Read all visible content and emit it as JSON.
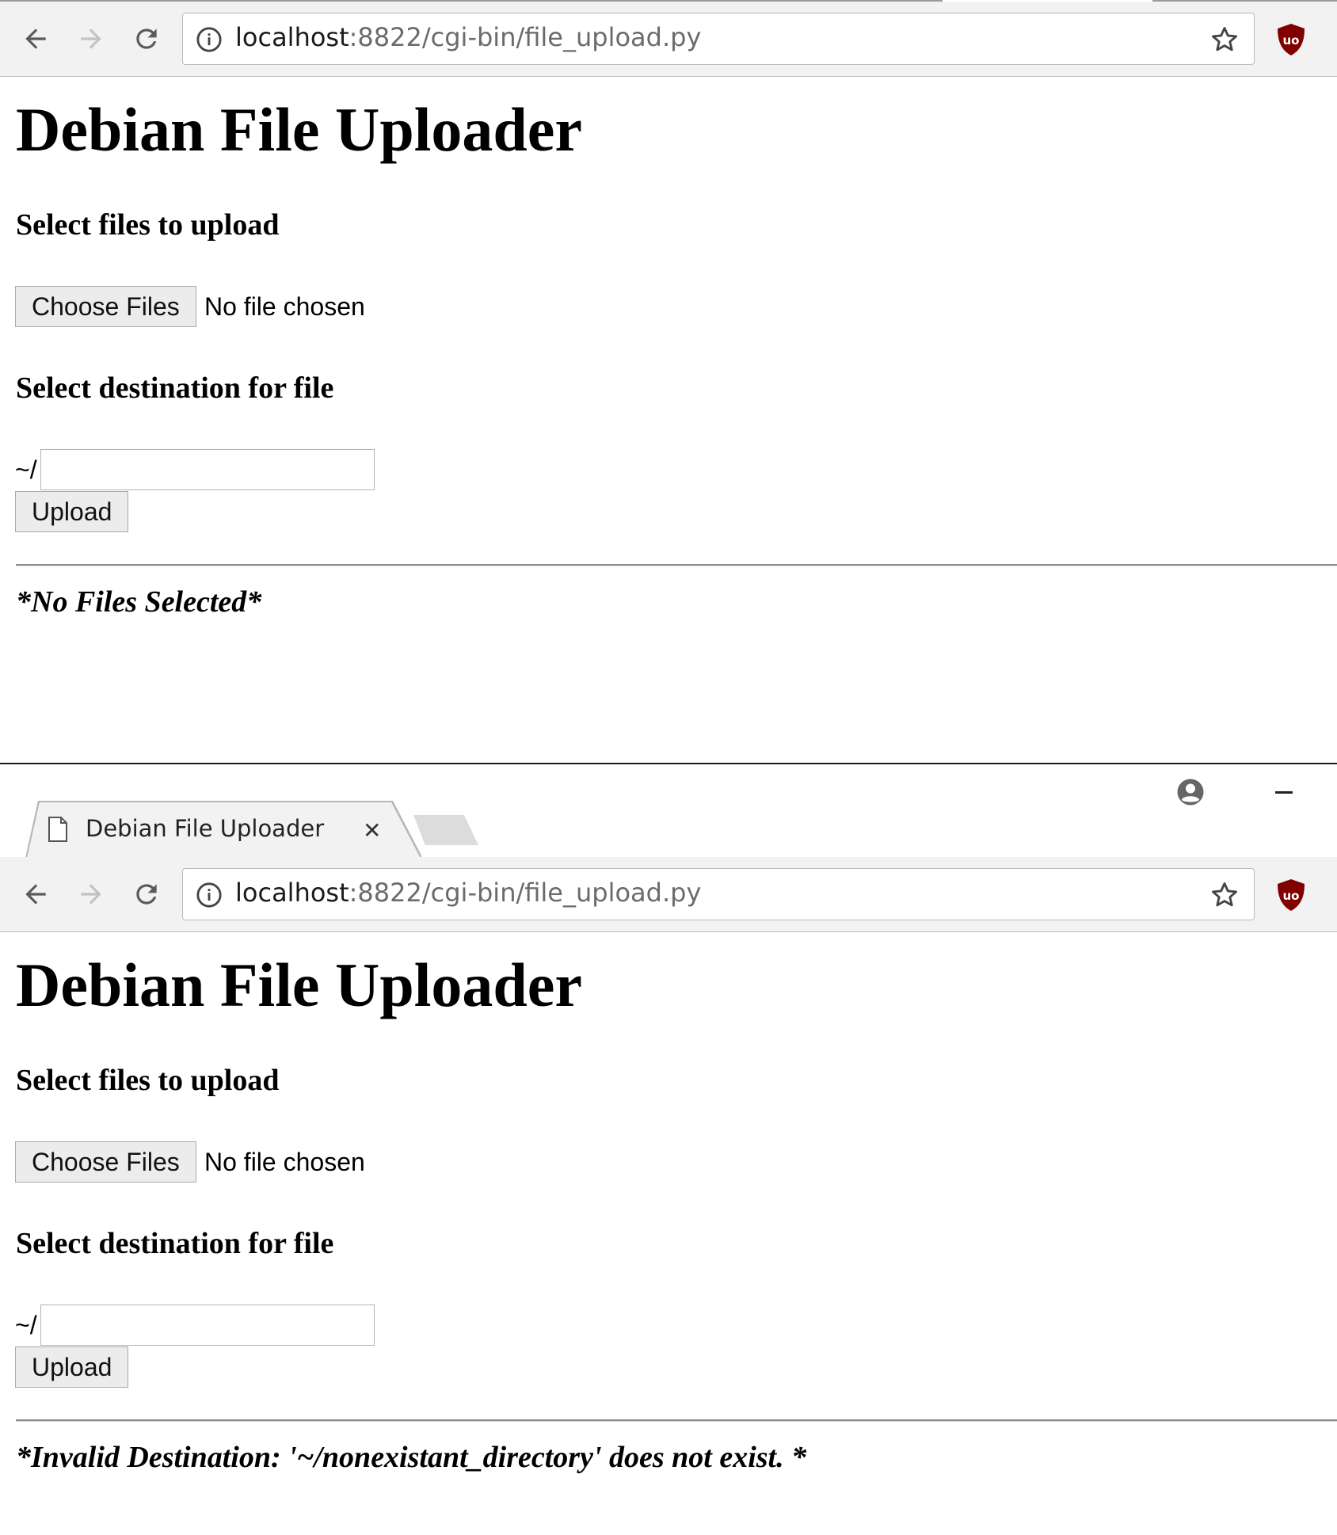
{
  "browser": {
    "tab_title": "Debian File Uploader",
    "url_host": "localhost",
    "url_rest": ":8822/cgi-bin/file_upload.py"
  },
  "page": {
    "title": "Debian File Uploader",
    "select_files_label": "Select files to upload",
    "choose_files_button": "Choose Files",
    "no_file_text": "No file chosen",
    "destination_label": "Select destination for file",
    "destination_prefix": "~/",
    "destination_value": "",
    "upload_button": "Upload"
  },
  "screens": [
    {
      "status_message": "*No Files Selected*"
    },
    {
      "status_message": "*Invalid Destination: '~/nonexistant_directory' does not exist. *"
    }
  ],
  "icons": {
    "back": "back-arrow-icon",
    "forward": "forward-arrow-icon",
    "reload": "reload-icon",
    "info": "info-icon",
    "bookmark": "star-icon",
    "extension": "ublock-icon",
    "profile": "profile-icon",
    "tab_page": "document-icon",
    "tab_close": "close-icon"
  },
  "colors": {
    "toolbar": "#f2f2f2",
    "ublock": "#800000"
  }
}
